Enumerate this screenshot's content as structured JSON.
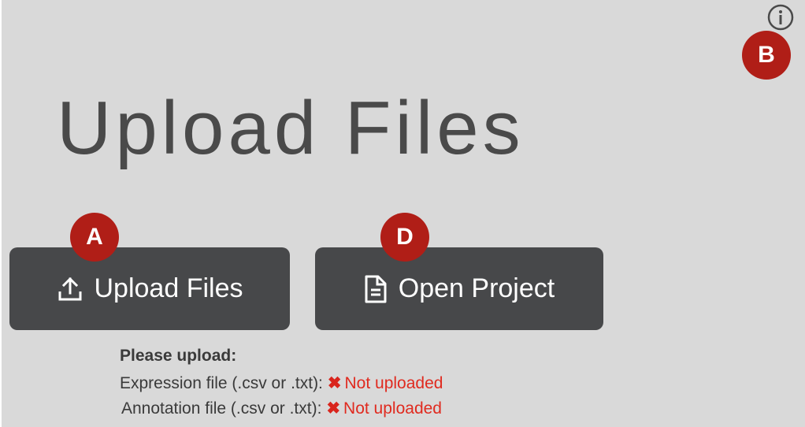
{
  "header": {
    "title": "Upload Files",
    "info_icon": "info-circle-icon"
  },
  "badges": {
    "a": "A",
    "b": "B",
    "d": "D"
  },
  "buttons": {
    "upload": {
      "label": "Upload Files",
      "icon": "upload-icon"
    },
    "open": {
      "label": "Open Project",
      "icon": "document-icon"
    }
  },
  "requirements": {
    "heading": "Please upload:",
    "items": [
      {
        "label": "Expression file (.csv or .txt):",
        "status": "Not uploaded",
        "status_icon": "x-mark-icon"
      },
      {
        "label": "Annotation file (.csv or .txt):",
        "status": "Not uploaded",
        "status_icon": "x-mark-icon"
      }
    ]
  },
  "colors": {
    "background": "#d9d9d9",
    "button": "#47484a",
    "badge": "#b01e17",
    "error": "#e02a1f"
  }
}
